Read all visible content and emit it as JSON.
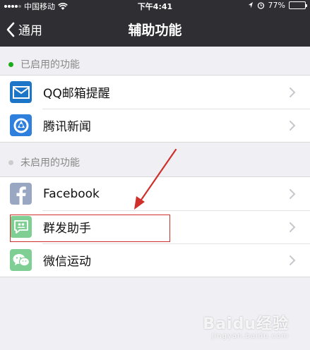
{
  "status_bar": {
    "carrier": "中国移动",
    "time": "下午4:41",
    "battery_text": "77%",
    "battery_level": 0.77,
    "battery_color": "#4cd964"
  },
  "nav": {
    "back_label": "通用",
    "title": "辅助功能"
  },
  "enabled_section": {
    "title": "已启用的功能",
    "dot_color": "#1aad19",
    "items": [
      {
        "label": "QQ邮箱提醒",
        "icon": "mail-icon",
        "icon_color": "#1d75c8"
      },
      {
        "label": "腾讯新闻",
        "icon": "tencent-news-icon",
        "icon_color": "#2f7fdd"
      }
    ]
  },
  "disabled_section": {
    "title": "未启用的功能",
    "dot_color": "#cccccc",
    "items": [
      {
        "label": "Facebook",
        "icon": "facebook-icon",
        "icon_color": "#9aa7c3"
      },
      {
        "label": "群发助手",
        "icon": "mass-message-icon",
        "icon_color": "#7fcf94"
      },
      {
        "label": "微信运动",
        "icon": "wechat-sport-icon",
        "icon_color": "#7fcf94"
      }
    ]
  },
  "annotation": {
    "highlight_color": "#d0302b"
  },
  "watermark": {
    "text": "Baidu经验",
    "subtext": "jingyan.baidu.com"
  }
}
